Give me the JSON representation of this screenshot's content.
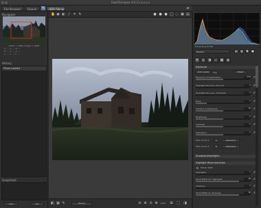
{
  "window": {
    "title": "RawTherapee 4.0.11.x.x.x.x"
  },
  "tabs": {
    "file_browser": "File Browser",
    "queue": "Queue",
    "editor": "HDR filename"
  },
  "left": {
    "navigator": "Navigator",
    "nav_info": "Width = 4288, Height = 2848",
    "info_lines": [
      "R: --- G: --- B: ---",
      "H: --- S: --- V: ---",
      "L: --- a: --- b: ---"
    ],
    "history": "History",
    "history_item": "Photo Loaded",
    "snapshots": "Snapshots",
    "add_btn": "Add",
    "del_btn": "Del"
  },
  "bottom": {
    "zoom": "100%",
    "button": "Queue"
  },
  "right": {
    "hist_info": "Processing Profile",
    "profile": "Neutral",
    "exposure_section": "Exposure",
    "auto_levels": "Auto Levels",
    "clip": "Clip",
    "reset_btn": "Reset",
    "rows": [
      {
        "label": "Exposure Compensation",
        "value": "0.00",
        "fill": 0.5
      },
      {
        "label": "Highlight Recovery Amount",
        "value": "0",
        "fill": 0.0
      },
      {
        "label": "Highlight Recovery Threshold",
        "value": "0",
        "fill": 0.0
      },
      {
        "label": "Black",
        "value": "0",
        "fill": 0.2
      },
      {
        "label": "Shadow Compression",
        "value": "50",
        "fill": 0.5
      },
      {
        "label": "Brightness",
        "value": "0",
        "fill": 0.5
      },
      {
        "label": "Contrast",
        "value": "0",
        "fill": 0.5
      },
      {
        "label": "Saturation",
        "value": "0",
        "fill": 0.5
      }
    ],
    "curve1": "Tone Curve 1",
    "curve2": "Tone Curve 2",
    "curve_mode": "Standard",
    "shadows_section": "Shadows/Highlights",
    "hl_section": "Highlight Reconstruction",
    "hl_rows": [
      {
        "label": "Highlights",
        "value": "0",
        "fill": 0.0
      },
      {
        "label": "Tonal Width for Highlights",
        "value": "80",
        "fill": 0.8
      },
      {
        "label": "Shadows",
        "value": "0",
        "fill": 0.0
      },
      {
        "label": "Tonal Width for Shadows",
        "value": "80",
        "fill": 0.8
      }
    ],
    "sharp_mask": "Sharp mask"
  }
}
